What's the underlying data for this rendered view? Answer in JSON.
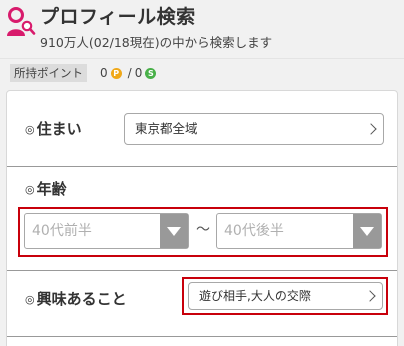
{
  "header": {
    "title": "プロフィール検索",
    "subtitle": "910万人(02/18現在)の中から検索します",
    "icon": "user-search-icon",
    "icon_color": "#d81b6c"
  },
  "points": {
    "label": "所持ポイント",
    "p_value": "0",
    "p_coin": "P",
    "separator": "/",
    "s_value": "0",
    "s_coin": "S",
    "p_color": "#f0a818",
    "s_color": "#48b048"
  },
  "form": {
    "residence": {
      "mark": "◎",
      "label": "住まい",
      "value": "東京都全域"
    },
    "age": {
      "mark": "◎",
      "label": "年齢",
      "from_value": "40代前半",
      "separator": "〜",
      "to_value": "40代後半"
    },
    "interests": {
      "mark": "◎",
      "label": "興味あること",
      "value": "遊び相手,大人の交際"
    }
  },
  "highlight_color": "#c8000b"
}
